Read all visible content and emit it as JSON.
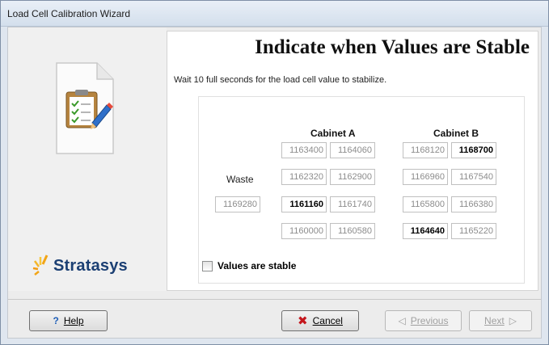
{
  "window": {
    "title": "Load Cell Calibration Wizard"
  },
  "heading": "Indicate when Values are Stable",
  "instruction": "Wait 10 full seconds for the load cell value to stabilize.",
  "brand": "Stratasys",
  "columns": {
    "cabinet_a": "Cabinet A",
    "cabinet_b": "Cabinet B"
  },
  "waste": {
    "label": "Waste",
    "value": "1169280"
  },
  "cabinet_a": [
    [
      "1163400",
      "1164060"
    ],
    [
      "1162320",
      "1162900"
    ],
    [
      "1161160",
      "1161740"
    ],
    [
      "1160000",
      "1160580"
    ]
  ],
  "cabinet_b": [
    [
      "1168120",
      "1168700"
    ],
    [
      "1166960",
      "1167540"
    ],
    [
      "1165800",
      "1166380"
    ],
    [
      "1164640",
      "1165220"
    ]
  ],
  "stable_checkbox": {
    "label": "Values are stable",
    "checked": false
  },
  "buttons": {
    "help": "Help",
    "cancel": "Cancel",
    "previous": "Previous",
    "next": "Next"
  },
  "colors": {
    "accent": "#1b3f73",
    "cancel_icon": "#c4161c"
  }
}
